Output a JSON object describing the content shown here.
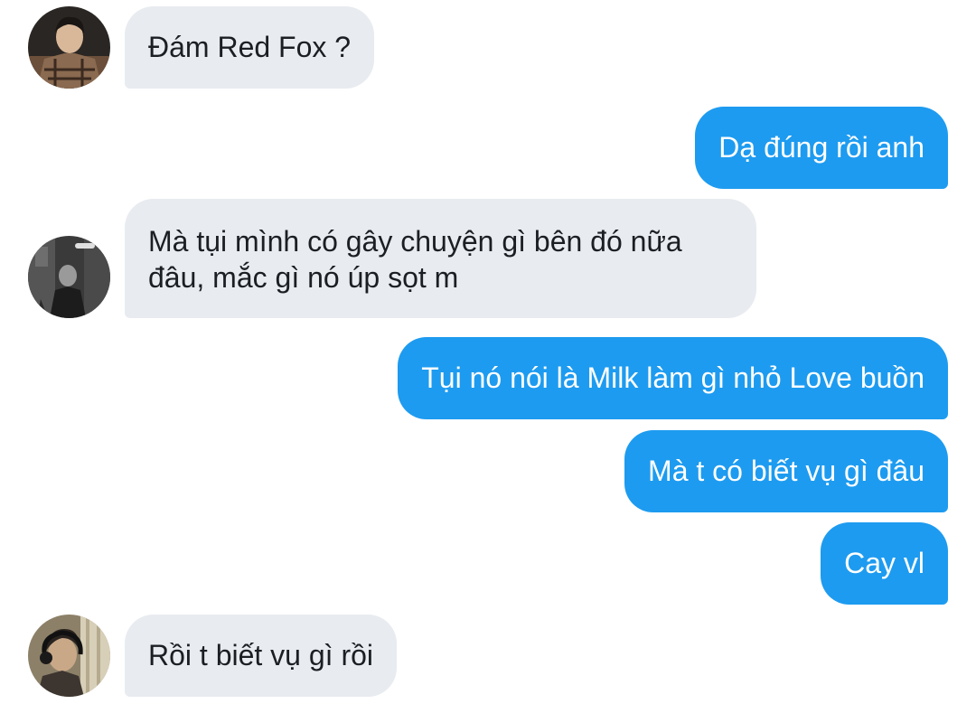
{
  "conversation": {
    "messages": [
      {
        "sender": "them",
        "avatar": "avatar-1",
        "text": "Đám Red Fox ?"
      },
      {
        "sender": "me",
        "text": "Dạ đúng rồi anh"
      },
      {
        "sender": "them",
        "avatar": "avatar-2",
        "text": "Mà tụi mình có gây chuyện gì bên đó nữa đâu, mắc gì nó úp sọt m"
      },
      {
        "sender": "me",
        "text": "Tụi nó nói là Milk làm gì nhỏ Love buồn"
      },
      {
        "sender": "me",
        "text": "Mà t có biết vụ gì đâu"
      },
      {
        "sender": "me",
        "text": "Cay vl"
      },
      {
        "sender": "them",
        "avatar": "avatar-3",
        "text": "Rồi t biết vụ gì rồi"
      }
    ]
  },
  "colors": {
    "incoming_bubble": "#e8ebef",
    "outgoing_bubble": "#1d9bf0",
    "incoming_text": "#1b1f23",
    "outgoing_text": "#ffffff"
  }
}
